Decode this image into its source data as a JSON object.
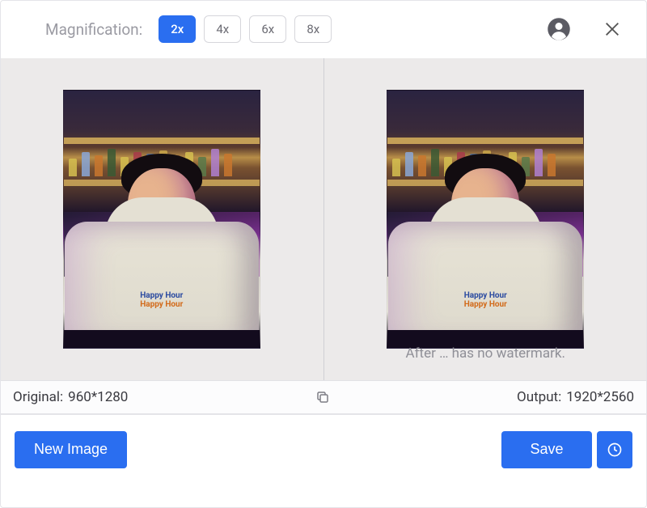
{
  "toolbar": {
    "label": "Magnification:",
    "options": [
      "2x",
      "4x",
      "6x",
      "8x"
    ],
    "selected": "2x"
  },
  "compare": {
    "watermark_note": "After … has no watermark.",
    "hoodie_line1": "Happy Hour",
    "hoodie_line2": "Happy Hour"
  },
  "info": {
    "original_label": "Original:",
    "original_value": "960*1280",
    "output_label": "Output:",
    "output_value": "1920*2560"
  },
  "footer": {
    "new_image": "New Image",
    "save": "Save"
  },
  "colors": {
    "primary": "#2a6ef0"
  }
}
